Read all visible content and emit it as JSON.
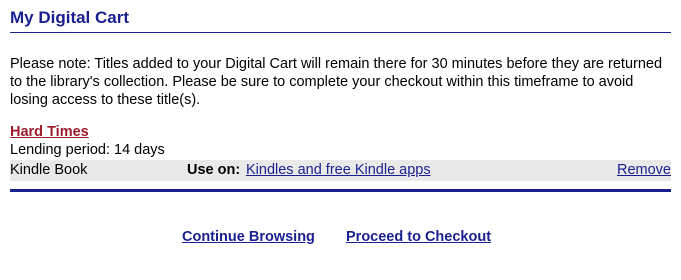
{
  "header": {
    "title": "My Digital Cart"
  },
  "notice": {
    "text": "Please note: Titles added to your Digital Cart will remain there for 30 minutes before they are returned to the library's collection. Please be sure to complete your checkout within this timeframe to avoid losing access to these title(s)."
  },
  "cart_item": {
    "title": "Hard Times",
    "lending_period": "Lending period: 14 days",
    "format": "Kindle Book",
    "use_on_label": "Use on:",
    "use_on_link": "Kindles and free Kindle apps",
    "remove_label": "Remove"
  },
  "actions": {
    "continue_label": "Continue Browsing",
    "checkout_label": "Proceed to Checkout"
  },
  "colors": {
    "heading": "#1a1f8f",
    "item_title": "#9b1c2c",
    "row_background": "#e9e9e9"
  }
}
